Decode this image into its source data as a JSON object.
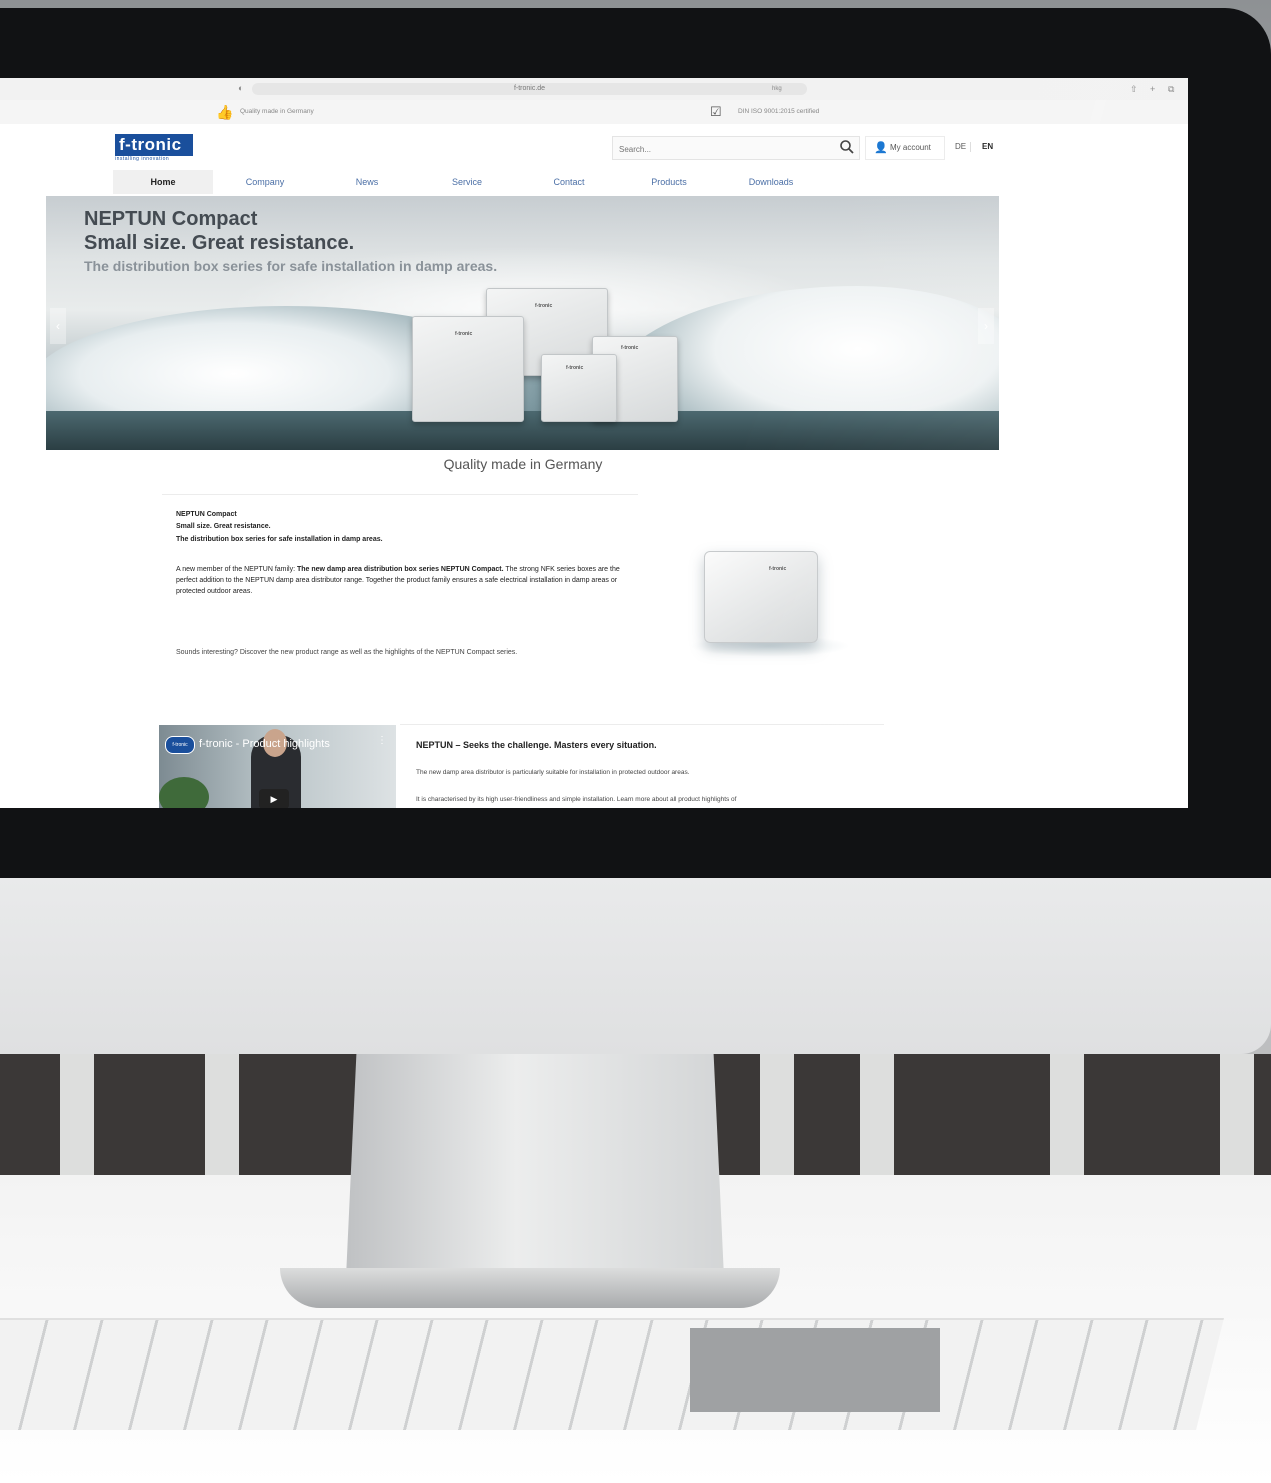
{
  "browser": {
    "url": "f-tronic.de",
    "url_right": "hkg",
    "icons": [
      "shield-icon",
      "share-icon",
      "new-tab-icon",
      "tabs-icon"
    ]
  },
  "topbar": {
    "left_text": "Quality made in Germany",
    "right_text": "DIN ISO 9001:2015 certified"
  },
  "logo": {
    "name": "f-tronic",
    "tagline": "installing innovation",
    "color": "#1a4f9c"
  },
  "search": {
    "placeholder": "Search..."
  },
  "account": {
    "label": "My account"
  },
  "languages": [
    "DE",
    "EN"
  ],
  "active_language": "EN",
  "nav": {
    "items": [
      "Home",
      "Company",
      "News",
      "Service",
      "Contact",
      "Products",
      "Downloads"
    ],
    "active": "Home",
    "link_color": "#4b6fa6"
  },
  "hero": {
    "title": "NEPTUN Compact",
    "subtitle": "Small size. Great resistance.",
    "line": "The distribution box series for safe installation in damp areas.",
    "box_brand": "f-tronic",
    "prev_icon": "chevron-left-icon",
    "next_icon": "chevron-right-icon"
  },
  "caption": "Quality made in Germany",
  "intro": {
    "title": "NEPTUN Compact",
    "subtitle": "Small size. Great resistance.",
    "line": "The distribution box series for safe installation in damp areas.",
    "para_start": "A new member of the NEPTUN family: ",
    "para_bold": "The new damp area distribution box series NEPTUN Compact.",
    "para_end": " The strong NFK series boxes are the perfect addition to the NEPTUN damp area distributor range. Together the product family ensures a safe electrical installation in damp areas or protected outdoor areas.",
    "discover": "Sounds interesting? Discover the new product range as well as the highlights of the NEPTUN Compact series."
  },
  "video": {
    "channel_logo": "f-tronic",
    "title": "f-tronic - Product highlights",
    "play_icon": "play-icon",
    "menu_icon": "more-vertical-icon"
  },
  "section2": {
    "heading": "NEPTUN – Seeks the challenge. Masters every situation.",
    "p1": "The new damp area distributor is particularly suitable for installation in protected outdoor areas.",
    "p2": "It is characterised by its high user-friendliness and simple installation. Learn more about all product highlights of"
  }
}
